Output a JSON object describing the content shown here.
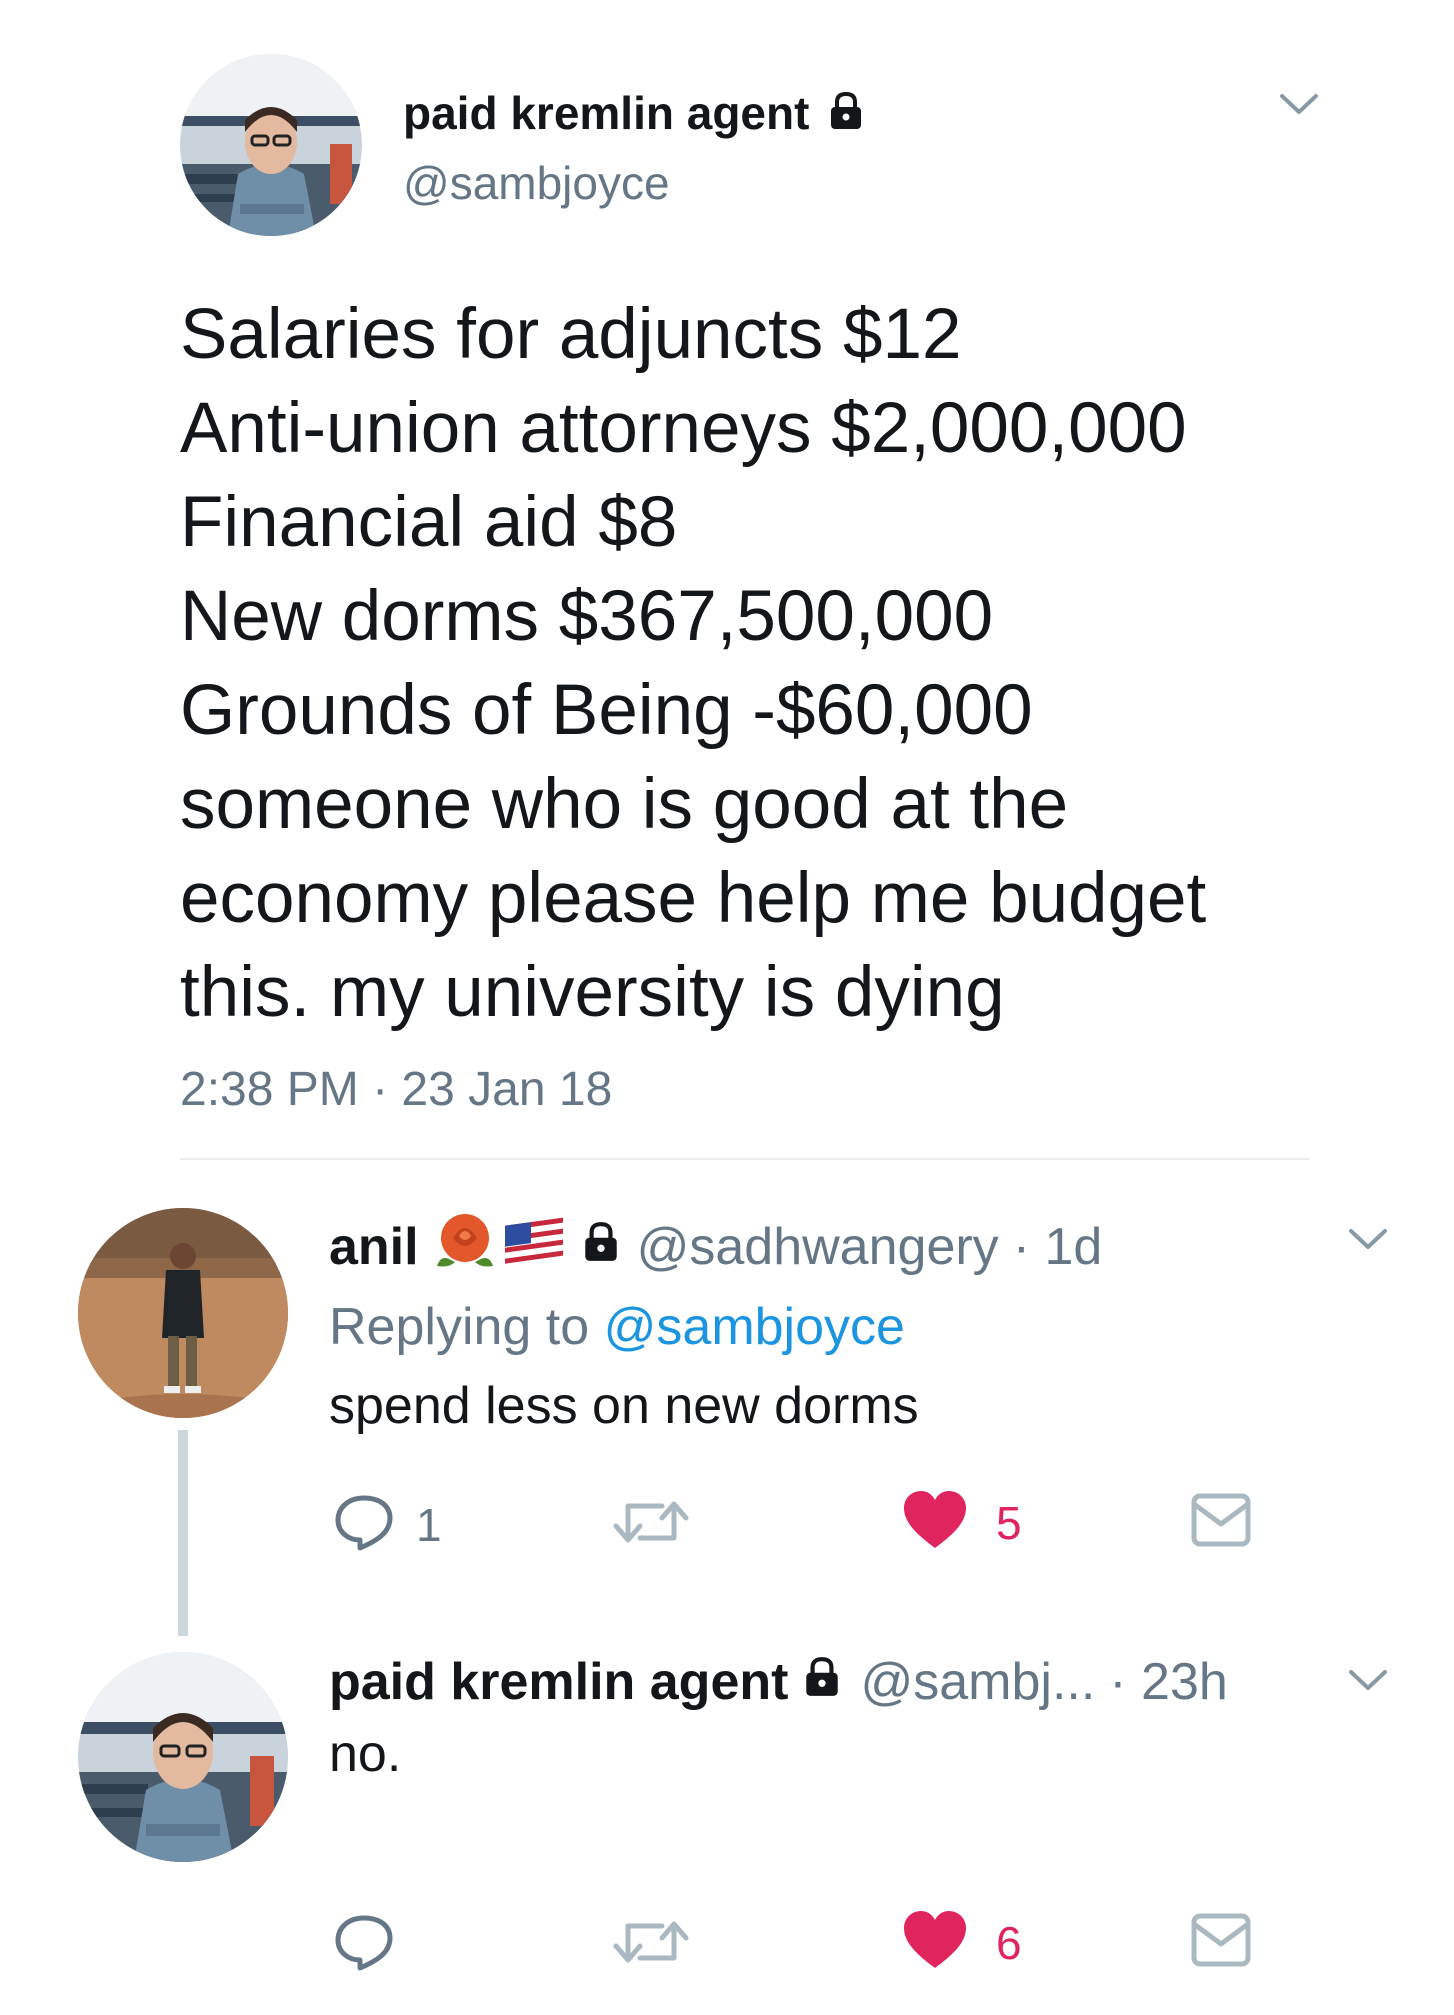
{
  "main_tweet": {
    "display_name": "paid kremlin agent",
    "handle": "@sambjoyce",
    "lines": [
      "Salaries for adjuncts $12",
      "Anti-union attorneys $2,000,000",
      "Financial aid $8",
      "New dorms $367,500,000",
      "Grounds of Being -$60,000",
      "someone who is good at the",
      "economy please help me budget",
      "this. my university is dying"
    ],
    "timestamp": "2:38 PM · 23 Jan 18"
  },
  "reply_1": {
    "display_name": "anil",
    "handle": "@sadhwangery",
    "age": "· 1d",
    "replying_prefix": "Replying to",
    "replying_to": "@sambjoyce",
    "text": "spend less on new dorms",
    "reply_count": "1",
    "like_count": "5"
  },
  "reply_2": {
    "display_name": "paid kremlin agent",
    "handle": "@sambj...",
    "age": "· 23h",
    "text": "no.",
    "like_count": "6"
  },
  "icons": [
    "lock-icon",
    "chevron-down-icon",
    "reply-icon",
    "retweet-icon",
    "heart-icon",
    "message-icon",
    "rose-emoji",
    "us-flag-emoji"
  ],
  "colors": {
    "link": "#1b95e0",
    "like": "#e0245e",
    "secondary": "#657786",
    "thread": "#ccd6dd"
  }
}
